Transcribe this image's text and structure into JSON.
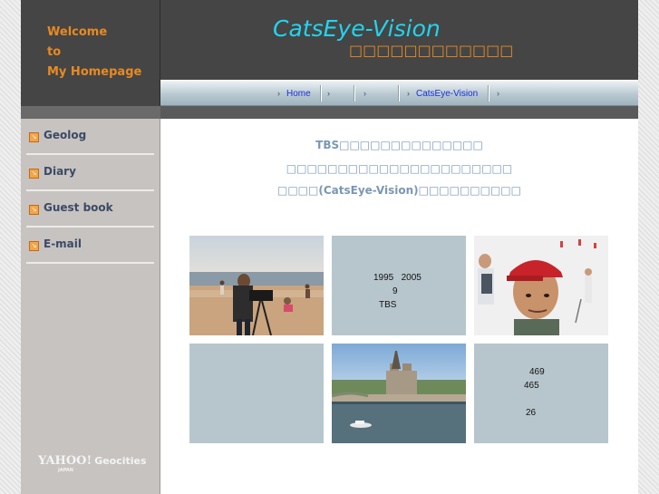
{
  "welcome": {
    "line1": "Welcome",
    "line2": "to",
    "line3": "My Homepage"
  },
  "header": {
    "title": "CatsEye-Vision",
    "subtitle": "□□□□□□□□□□□□"
  },
  "nav": {
    "items": [
      "Home",
      "",
      "",
      "CatsEye-Vision",
      ""
    ]
  },
  "sidebar": {
    "items": [
      "Geolog",
      "Diary",
      "Guest book",
      "E-mail"
    ],
    "logo": {
      "yahoo": "YAHOO!",
      "geocities": "Geocities",
      "japan": "JAPAN"
    }
  },
  "content": {
    "intro": [
      "TBS□□□□□□□□□□□□□□",
      "□□□□□□□□□□□□□□□□□□□□□□",
      "□□□□(CatsEye-Vision)□□□□□□□□□□"
    ],
    "tile2": {
      "line1": "1995   2005",
      "line2": "9",
      "line3": "TBS"
    },
    "tile6": {
      "line1": "469",
      "line2": "465",
      "line3": "26"
    }
  },
  "colors": {
    "accent": "#e88a22",
    "title": "#22d4ee",
    "tile": "#b7c6cd"
  }
}
